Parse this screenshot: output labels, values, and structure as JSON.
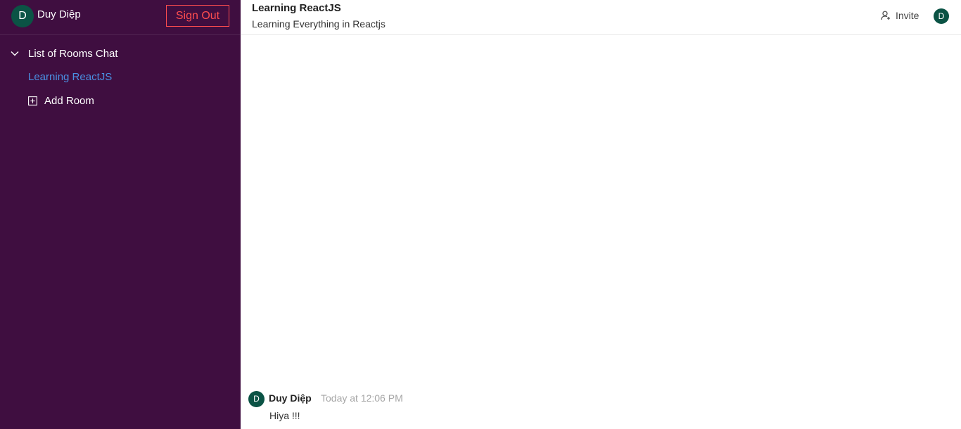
{
  "sidebar": {
    "user": {
      "avatar_initial": "D",
      "name": "Duy Diệp",
      "signout_label": "Sign Out"
    },
    "room_list": {
      "header_label": "List of Rooms Chat",
      "rooms": [
        {
          "name": "Learning ReactJS"
        }
      ],
      "add_room_label": "Add Room"
    }
  },
  "chat": {
    "header": {
      "title": "Learning ReactJS",
      "description": "Learning Everything in Reactjs",
      "invite_label": "Invite",
      "member_initial": "D"
    },
    "messages": [
      {
        "avatar_initial": "D",
        "author": "Duy Diệp",
        "time": "Today at 12:06 PM",
        "text": "Hiya !!!"
      }
    ]
  },
  "colors": {
    "sidebar_bg": "#3f0e40",
    "avatar_bg": "#0b5345",
    "signout": "#ff4d4f",
    "active_room": "#4a90e2"
  },
  "icons": {
    "room_list_toggle": "chevron-down-icon",
    "add_room": "plus-square-icon",
    "invite": "user-add-icon"
  }
}
